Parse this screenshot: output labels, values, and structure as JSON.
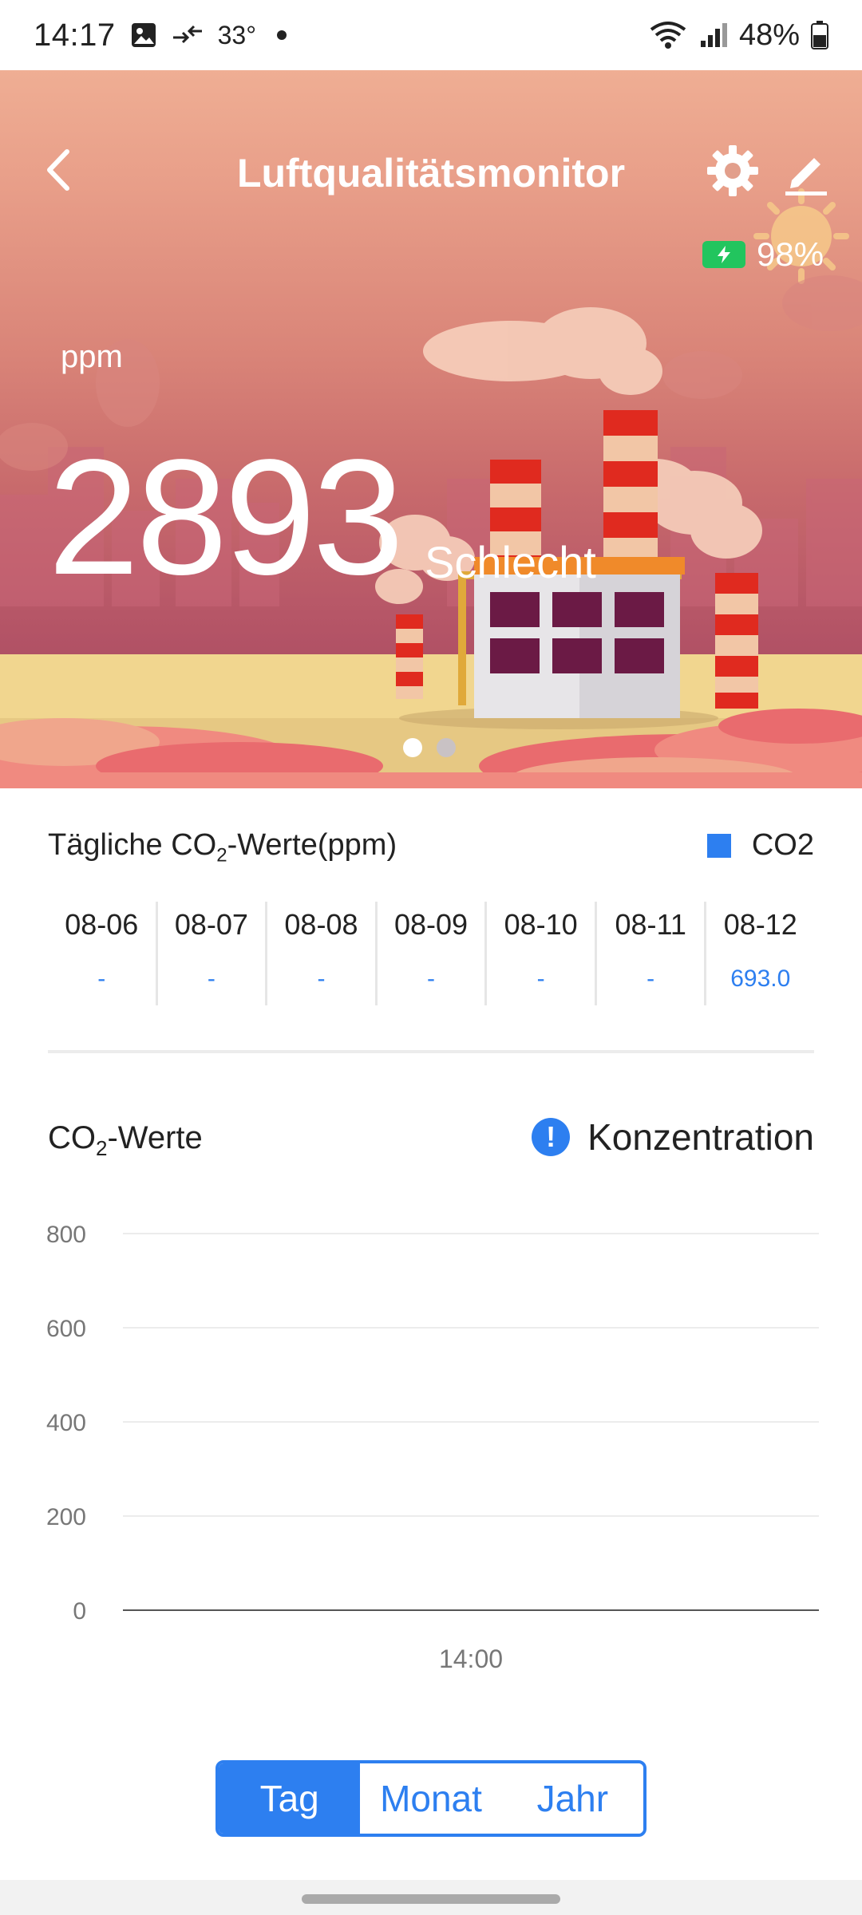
{
  "status_bar": {
    "time": "14:17",
    "temperature": "33°",
    "battery": "48%"
  },
  "header": {
    "title": "Luftqualitätsmonitor"
  },
  "device": {
    "battery_percent": "98%"
  },
  "reading": {
    "unit": "ppm",
    "value": "2893",
    "status": "Schlecht"
  },
  "carousel": {
    "pages": 2,
    "active_index": 0
  },
  "daily": {
    "title_pre": "Tägliche CO",
    "title_sub": "2",
    "title_post": "-Werte(ppm)",
    "legend_label": "CO2",
    "legend_color": "#2d7ff0",
    "days": [
      {
        "date": "08-06",
        "value": "-"
      },
      {
        "date": "08-07",
        "value": "-"
      },
      {
        "date": "08-08",
        "value": "-"
      },
      {
        "date": "08-09",
        "value": "-"
      },
      {
        "date": "08-10",
        "value": "-"
      },
      {
        "date": "08-11",
        "value": "-"
      },
      {
        "date": "08-12",
        "value": "693.0"
      }
    ]
  },
  "chart_section": {
    "title_pre": "CO",
    "title_sub": "2",
    "title_post": "-Werte",
    "concentration_label": "Konzentration",
    "info_icon": "info-icon"
  },
  "chart_data": {
    "type": "line",
    "title": "",
    "ylim": [
      0,
      800
    ],
    "yticks": [
      "800",
      "600",
      "400",
      "200",
      "0"
    ],
    "x_tick_labels": [
      "14:00"
    ],
    "series": [],
    "grid": true
  },
  "period_tabs": {
    "items": [
      "Tag",
      "Monat",
      "Jahr"
    ],
    "active": "Tag"
  },
  "colors": {
    "accent": "#2d7ff0",
    "battery_green": "#22c55e"
  }
}
